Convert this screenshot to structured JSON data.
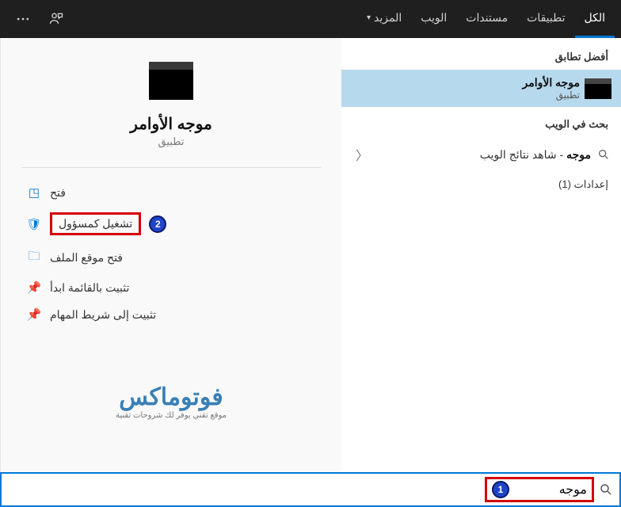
{
  "topbar": {
    "tabs": {
      "all": "الكل",
      "apps": "تطبيقات",
      "documents": "مستندات",
      "web": "الويب",
      "more": "المزيد"
    }
  },
  "results": {
    "bestMatchLabel": "أفضل تطابق",
    "bestMatch": {
      "title": "موجه الأوامر",
      "sub": "تطبيق"
    },
    "webSearchLabel": "بحث في الويب",
    "webItem": {
      "query": "موجه",
      "suffix": " - شاهد نتائج الويب"
    },
    "settings": "إعدادات (1)"
  },
  "details": {
    "title": "موجه الأوامر",
    "type": "تطبيق",
    "actions": {
      "open": "فتح",
      "runAdmin": "تشغيل كمسؤول",
      "openLocation": "فتح موقع الملف",
      "pinStart": "تثبيت بالقائمة ابدأ",
      "pinTaskbar": "تثبيت إلى شريط المهام"
    }
  },
  "watermark": {
    "big": "فوتوماكس",
    "small": "موقع تقني يوفر لك شروحات تقنية"
  },
  "search": {
    "value": "موجه"
  },
  "annotations": {
    "badge1": "1",
    "badge2": "2"
  }
}
